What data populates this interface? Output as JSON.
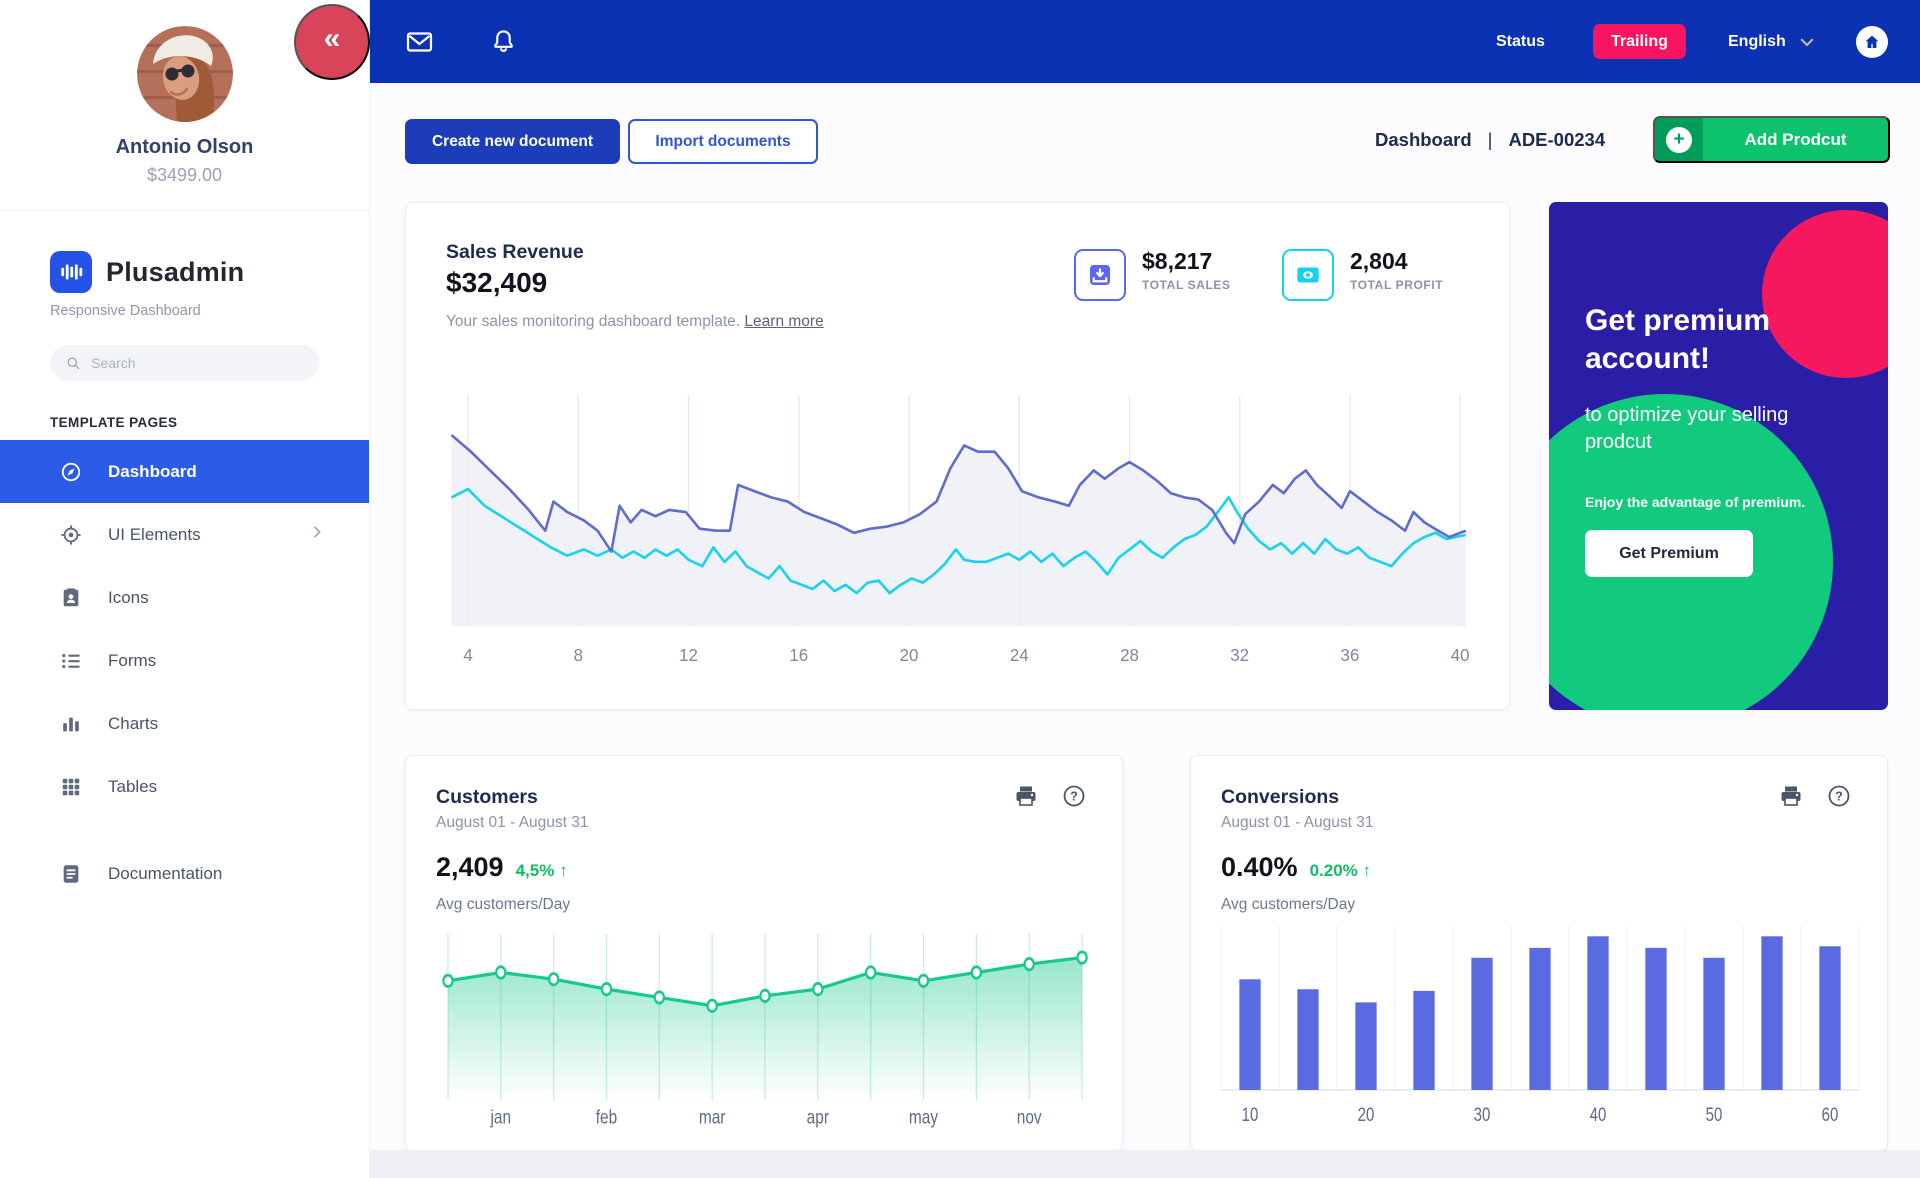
{
  "user": {
    "name": "Antonio Olson",
    "balance": "$3499.00"
  },
  "brand": {
    "name": "Plusadmin",
    "tagline": "Responsive Dashboard"
  },
  "search": {
    "placeholder": "Search"
  },
  "sidebar": {
    "section": "TEMPLATE PAGES",
    "nav": [
      {
        "label": "Dashboard",
        "icon": "compass-icon",
        "active": true
      },
      {
        "label": "UI Elements",
        "icon": "target-icon",
        "has_submenu": true
      },
      {
        "label": "Icons",
        "icon": "id-badge-icon"
      },
      {
        "label": "Forms",
        "icon": "list-icon"
      },
      {
        "label": "Charts",
        "icon": "bar-chart-icon"
      },
      {
        "label": "Tables",
        "icon": "grid-icon"
      },
      {
        "label": "Documentation",
        "icon": "document-icon"
      }
    ]
  },
  "topbar": {
    "collapse": "«",
    "status": "Status",
    "badge": "Trailing",
    "language": "English"
  },
  "actions": {
    "create": "Create new document",
    "import": "Import documents",
    "add_product": "Add Prodcut"
  },
  "breadcrumb": {
    "page": "Dashboard",
    "separator": "|",
    "code": "ADE-00234"
  },
  "sales": {
    "title": "Sales Revenue",
    "value": "$32,409",
    "subtitle": "Your sales monitoring dashboard template.",
    "link": "Learn more",
    "stats": [
      {
        "value": "$8,217",
        "label": "TOTAL SALES",
        "color": "#5b67f2"
      },
      {
        "value": "2,804",
        "label": "TOTAL PROFIT",
        "color": "#10d2f2"
      }
    ]
  },
  "premium": {
    "heading": "Get premium account!",
    "subheading": "to optimize your selling prodcut",
    "note": "Enjoy the advantage of premium.",
    "button": "Get Premium"
  },
  "customers": {
    "title": "Customers",
    "range": "August 01 - August 31",
    "value": "2,409",
    "delta": "4,5%",
    "arrow": "↑",
    "caption": "Avg customers/Day"
  },
  "conversions": {
    "title": "Conversions",
    "range": "August 01 - August 31",
    "value": "0.40%",
    "delta": "0.20%",
    "arrow": "↑",
    "caption": "Avg customers/Day"
  },
  "colors": {
    "topbar": "#0c32b4",
    "active_nav": "#2c5be8",
    "primary_btn": "#1d3cba",
    "outline_btn": "#2f55d9",
    "pink_badge": "#f8155f",
    "collapse_red": "#d8445a",
    "green_btn": "#0ec36d",
    "green_btn_dark": "#009d58",
    "premium_bg": "#2b1ea6",
    "premium_pink": "#f6185f",
    "premium_green": "#12ca7e",
    "line_primary": "#5f6cce",
    "line_secondary": "#19d2f0",
    "area_green": "#16c98c",
    "bars": "#5a6ae0",
    "delta_green": "#0fbf62"
  },
  "chart_data": [
    {
      "type": "line",
      "title": "Sales Revenue",
      "x_ticks": [
        4,
        8,
        12,
        16,
        20,
        24,
        28,
        32,
        36,
        40
      ],
      "x_range": [
        3.2,
        40.5
      ],
      "ylim": [
        0,
        100
      ],
      "grid": "vertical",
      "legend": "none",
      "area_fill": "#eef0f7",
      "series": [
        {
          "name": "revenue-primary",
          "color": "#5f6cce",
          "points": [
            [
              3.4,
              92
            ],
            [
              4.1,
              84
            ],
            [
              4.8,
              75
            ],
            [
              5.5,
              66
            ],
            [
              6.2,
              56
            ],
            [
              6.8,
              46
            ],
            [
              7.1,
              60
            ],
            [
              7.6,
              55
            ],
            [
              8.2,
              51
            ],
            [
              8.7,
              46
            ],
            [
              9.2,
              36
            ],
            [
              9.5,
              58
            ],
            [
              9.9,
              50
            ],
            [
              10.3,
              56
            ],
            [
              10.8,
              53
            ],
            [
              11.3,
              56
            ],
            [
              11.9,
              55
            ],
            [
              12.4,
              47
            ],
            [
              13.0,
              46
            ],
            [
              13.5,
              46
            ],
            [
              13.8,
              68
            ],
            [
              14.4,
              65
            ],
            [
              15.0,
              62
            ],
            [
              15.6,
              60
            ],
            [
              16.2,
              55
            ],
            [
              16.8,
              52
            ],
            [
              17.4,
              49
            ],
            [
              18.0,
              45
            ],
            [
              18.6,
              47
            ],
            [
              19.2,
              48
            ],
            [
              19.8,
              50
            ],
            [
              20.4,
              54
            ],
            [
              21.0,
              60
            ],
            [
              21.5,
              76
            ],
            [
              22.0,
              87
            ],
            [
              22.5,
              84
            ],
            [
              23.1,
              84
            ],
            [
              23.6,
              76
            ],
            [
              24.1,
              65
            ],
            [
              24.7,
              62
            ],
            [
              25.3,
              60
            ],
            [
              25.8,
              58
            ],
            [
              26.2,
              68
            ],
            [
              26.7,
              75
            ],
            [
              27.1,
              71
            ],
            [
              27.6,
              76
            ],
            [
              28.0,
              79
            ],
            [
              28.5,
              75
            ],
            [
              29.0,
              70
            ],
            [
              29.5,
              64
            ],
            [
              30.0,
              62
            ],
            [
              30.5,
              61
            ],
            [
              31.0,
              56
            ],
            [
              31.5,
              45
            ],
            [
              31.8,
              40
            ],
            [
              32.2,
              54
            ],
            [
              32.7,
              60
            ],
            [
              33.2,
              68
            ],
            [
              33.6,
              64
            ],
            [
              34.0,
              71
            ],
            [
              34.4,
              75
            ],
            [
              34.8,
              68
            ],
            [
              35.3,
              62
            ],
            [
              35.7,
              57
            ],
            [
              36.0,
              65
            ],
            [
              36.5,
              60
            ],
            [
              37.0,
              55
            ],
            [
              37.5,
              51
            ],
            [
              38.0,
              46
            ],
            [
              38.3,
              55
            ],
            [
              38.7,
              50
            ],
            [
              39.2,
              46
            ],
            [
              39.6,
              43
            ],
            [
              40.2,
              46
            ]
          ]
        },
        {
          "name": "revenue-secondary",
          "color": "#19d2f0",
          "points": [
            [
              3.4,
              62
            ],
            [
              4.0,
              66
            ],
            [
              4.6,
              58
            ],
            [
              5.2,
              53
            ],
            [
              5.8,
              48
            ],
            [
              6.4,
              43
            ],
            [
              7.0,
              38
            ],
            [
              7.6,
              34
            ],
            [
              8.2,
              37
            ],
            [
              8.7,
              34
            ],
            [
              9.2,
              37
            ],
            [
              9.6,
              33
            ],
            [
              10.0,
              36
            ],
            [
              10.4,
              33
            ],
            [
              10.8,
              37
            ],
            [
              11.2,
              34
            ],
            [
              11.6,
              37
            ],
            [
              12.0,
              32
            ],
            [
              12.5,
              29
            ],
            [
              12.9,
              38
            ],
            [
              13.3,
              31
            ],
            [
              13.7,
              36
            ],
            [
              14.1,
              29
            ],
            [
              14.5,
              26
            ],
            [
              14.9,
              23
            ],
            [
              15.3,
              29
            ],
            [
              15.7,
              22
            ],
            [
              16.1,
              20
            ],
            [
              16.5,
              18
            ],
            [
              16.9,
              22
            ],
            [
              17.3,
              17
            ],
            [
              17.7,
              20
            ],
            [
              18.1,
              16
            ],
            [
              18.5,
              21
            ],
            [
              18.9,
              22
            ],
            [
              19.3,
              16
            ],
            [
              19.7,
              20
            ],
            [
              20.1,
              23
            ],
            [
              20.5,
              21
            ],
            [
              20.9,
              25
            ],
            [
              21.3,
              30
            ],
            [
              21.7,
              37
            ],
            [
              22.0,
              32
            ],
            [
              22.4,
              31
            ],
            [
              22.8,
              31
            ],
            [
              23.2,
              33
            ],
            [
              23.6,
              35
            ],
            [
              24.0,
              32
            ],
            [
              24.4,
              36
            ],
            [
              24.8,
              31
            ],
            [
              25.2,
              35
            ],
            [
              25.6,
              29
            ],
            [
              26.0,
              33
            ],
            [
              26.4,
              36
            ],
            [
              26.8,
              31
            ],
            [
              27.2,
              25
            ],
            [
              27.6,
              33
            ],
            [
              28.0,
              37
            ],
            [
              28.4,
              41
            ],
            [
              28.8,
              36
            ],
            [
              29.2,
              33
            ],
            [
              29.6,
              38
            ],
            [
              30.0,
              42
            ],
            [
              30.4,
              44
            ],
            [
              30.8,
              48
            ],
            [
              31.2,
              55
            ],
            [
              31.6,
              62
            ],
            [
              31.9,
              55
            ],
            [
              32.3,
              47
            ],
            [
              32.7,
              41
            ],
            [
              33.1,
              37
            ],
            [
              33.5,
              40
            ],
            [
              33.9,
              35
            ],
            [
              34.3,
              40
            ],
            [
              34.7,
              35
            ],
            [
              35.1,
              42
            ],
            [
              35.5,
              37
            ],
            [
              35.9,
              35
            ],
            [
              36.3,
              38
            ],
            [
              36.7,
              33
            ],
            [
              37.1,
              31
            ],
            [
              37.5,
              29
            ],
            [
              37.9,
              35
            ],
            [
              38.3,
              40
            ],
            [
              38.7,
              43
            ],
            [
              39.1,
              45
            ],
            [
              39.5,
              42
            ],
            [
              40.2,
              44
            ]
          ]
        }
      ]
    },
    {
      "type": "area",
      "title": "Customers Avg customers/Day",
      "categories": [
        "",
        "jan",
        "",
        "feb",
        "",
        "mar",
        "",
        "apr",
        "",
        "may",
        "",
        "nov",
        ""
      ],
      "values": [
        79,
        84,
        80,
        74,
        69,
        64,
        70,
        74,
        84,
        79,
        84,
        89,
        93
      ],
      "ylim": [
        0,
        100
      ],
      "line_color": "#16c98c",
      "marker": "circle-white",
      "grid": "vertical-green"
    },
    {
      "type": "bar",
      "title": "Conversions Avg customers/Day",
      "categories": [
        "10",
        "",
        "20",
        "",
        "30",
        "",
        "40",
        "",
        "50",
        "",
        "60"
      ],
      "values": [
        67,
        61,
        53,
        60,
        80,
        86,
        93,
        86,
        80,
        93,
        87
      ],
      "ylim": [
        0,
        100
      ],
      "bar_color": "#5a6ae0",
      "grid": "vertical"
    }
  ]
}
